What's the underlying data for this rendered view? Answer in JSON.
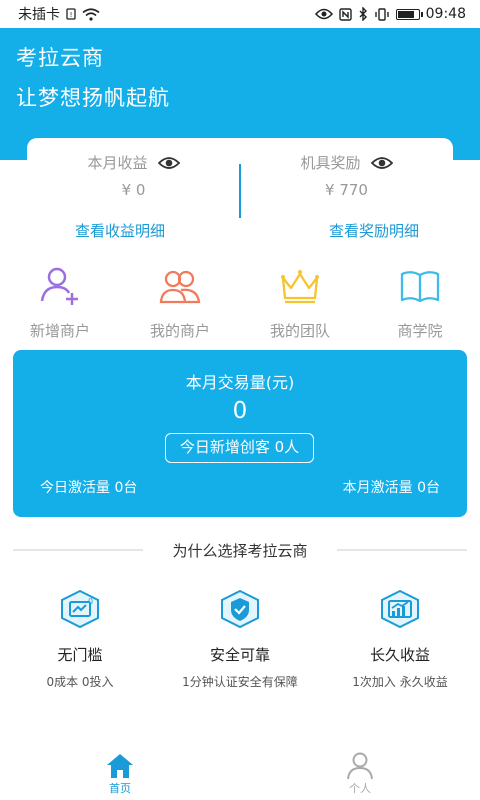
{
  "status_bar": {
    "carrier": "未插卡",
    "time": "09:48",
    "battery_level": 0.85
  },
  "hero": {
    "title": "考拉云商",
    "subtitle": "让梦想扬帆起航"
  },
  "earnings": {
    "month_income_label": "本月收益",
    "month_income_value": "¥ 0",
    "reward_label": "机具奖励",
    "reward_value": "¥ 770",
    "income_detail_link": "查看收益明细",
    "reward_detail_link": "查看奖励明细"
  },
  "quick_menu": [
    {
      "label": "新增商户",
      "icon": "add-user-icon",
      "color": "#9b6fe0"
    },
    {
      "label": "我的商户",
      "icon": "users-icon",
      "color": "#f07a5a"
    },
    {
      "label": "我的团队",
      "icon": "crown-icon",
      "color": "#f5c531"
    },
    {
      "label": "商学院",
      "icon": "book-icon",
      "color": "#3cbde8"
    }
  ],
  "volume": {
    "title": "本月交易量(元)",
    "value": "0",
    "today_new_label": "今日新增创客 0人",
    "today_activation": "今日激活量 0台",
    "month_activation": "本月激活量 0台"
  },
  "why": {
    "title": "为什么选择考拉云商"
  },
  "features": [
    {
      "title": "无门槛",
      "desc": "0成本 0投入",
      "icon": "zero-cost-icon"
    },
    {
      "title": "安全可靠",
      "desc": "1分钟认证安全有保障",
      "icon": "shield-check-icon"
    },
    {
      "title": "长久收益",
      "desc": "1次加入 永久收益",
      "icon": "growth-chart-icon"
    }
  ],
  "tabs": [
    {
      "label": "首页",
      "icon": "home-icon"
    },
    {
      "label": "个人",
      "icon": "person-icon"
    }
  ],
  "colors": {
    "brand": "#14aee8",
    "link": "#1a9ad6"
  }
}
